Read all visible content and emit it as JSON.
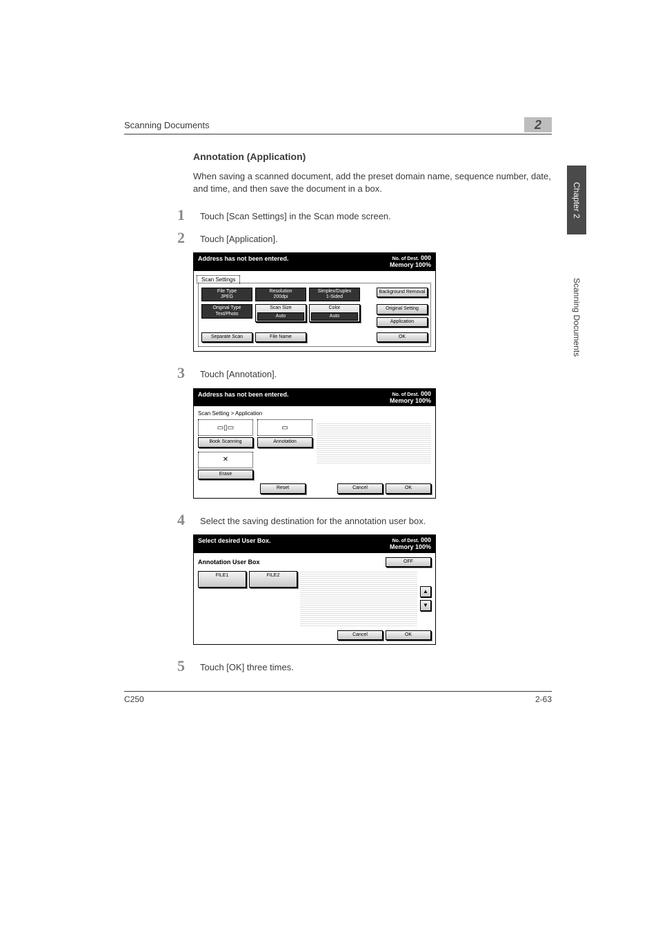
{
  "running_head": "Scanning Documents",
  "chapter_number": "2",
  "section_heading": "Annotation (Application)",
  "intro": "When saving a scanned document, add the preset domain name, sequence number, date, and time, and then save the document in a box.",
  "steps": {
    "s1": {
      "num": "1",
      "text": "Touch [Scan Settings] in the Scan mode screen."
    },
    "s2": {
      "num": "2",
      "text": "Touch [Application]."
    },
    "s3": {
      "num": "3",
      "text": "Touch [Annotation]."
    },
    "s4": {
      "num": "4",
      "text": "Select the saving destination for the annotation user box."
    },
    "s5": {
      "num": "5",
      "text": "Touch [OK] three times."
    }
  },
  "ui2": {
    "header_left": "Address has not been entered.",
    "header_right_top": "No. of Dest.",
    "header_right_val": "000",
    "header_right_bot": "Memory 100%",
    "tab": "Scan Settings",
    "row1": {
      "a_label": "File Type",
      "a_val": "JPEG",
      "b_label": "Resolution",
      "b_val": "200dpi",
      "c_label": "Simplex/Duplex",
      "c_val": "1-Sided",
      "side1": "Background Removal"
    },
    "row2": {
      "a_label": "Original Type",
      "a_val": "Text/Photo",
      "b_label": "Scan Size",
      "b_val": "Auto",
      "c_label": "Color",
      "c_val": "Auto",
      "side1": "Original Setting",
      "side2": "Application"
    },
    "footer": {
      "a": "Separate Scan",
      "b": "File Name",
      "ok": "OK"
    }
  },
  "ui3": {
    "header_left": "Address has not been entered.",
    "header_right_top": "No. of Dest.",
    "header_right_val": "000",
    "header_right_bot": "Memory 100%",
    "breadcrumb": "Scan Setting > Application",
    "book_btn": "Book Scanning",
    "annotation_btn": "Annotation",
    "erase_btn": "Erase",
    "reset": "Reset",
    "cancel": "Cancel",
    "ok": "OK"
  },
  "ui4": {
    "header_left": "Select desired User Box.",
    "header_right_top": "No. of Dest.",
    "header_right_val": "000",
    "header_right_bot": "Memory 100%",
    "subtitle": "Annotation User Box",
    "off": "OFF",
    "file1": "FILE1",
    "file2": "FILE2",
    "cancel": "Cancel",
    "ok": "OK"
  },
  "side_tab_dark": "Chapter 2",
  "side_tab_label": "Scanning Documents",
  "footer_left": "C250",
  "footer_right": "2-63"
}
